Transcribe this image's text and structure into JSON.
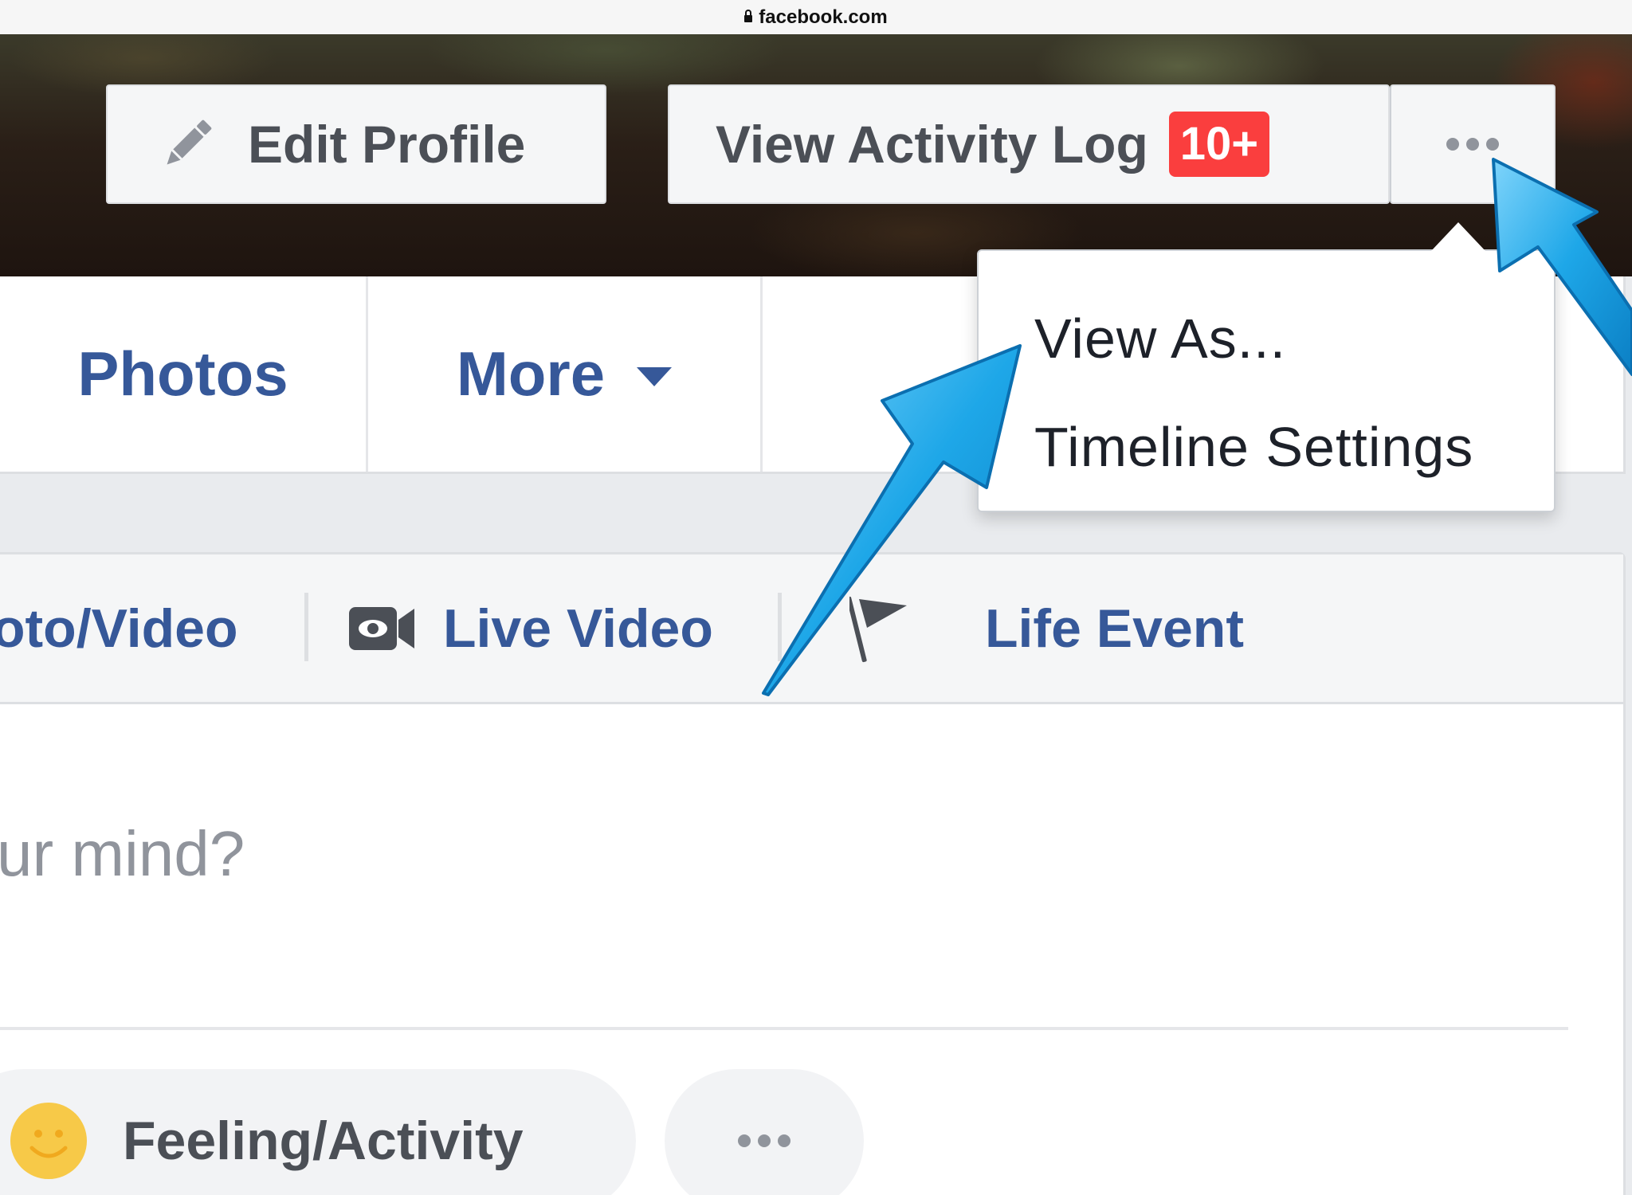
{
  "browser": {
    "url": "facebook.com"
  },
  "cover": {
    "edit_profile_label": "Edit Profile",
    "activity_log_label": "View Activity Log",
    "activity_badge": "10+"
  },
  "tabs": [
    {
      "label": "Photos"
    },
    {
      "label": "More"
    }
  ],
  "dropdown": {
    "items": [
      {
        "label": "View As..."
      },
      {
        "label": "Timeline Settings"
      }
    ]
  },
  "composer": {
    "tabs": [
      {
        "label": "oto/Video"
      },
      {
        "label": "Live Video"
      },
      {
        "label": "Life Event"
      }
    ],
    "prompt": "ur mind?",
    "feeling_label": "Feeling/Activity"
  },
  "colors": {
    "link_blue": "#365899",
    "badge_red": "#fa3e3e",
    "arrow_blue": "#1ea7e8"
  },
  "icons": [
    "lock-icon",
    "pencil-icon",
    "more-dots-icon",
    "caret-down-icon",
    "video-camera-icon",
    "flag-icon",
    "smiley-icon"
  ]
}
